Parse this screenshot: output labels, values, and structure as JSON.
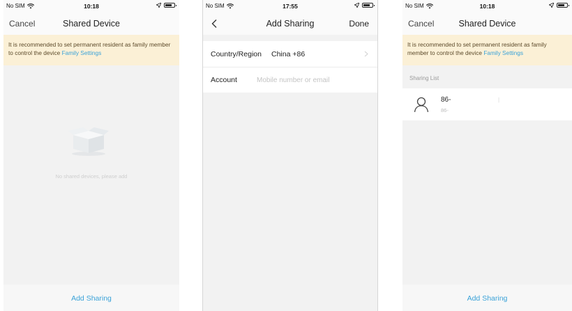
{
  "screens": [
    {
      "status": {
        "carrier": "No SIM",
        "time": "10:18"
      },
      "nav": {
        "left": "Cancel",
        "title": "Shared Device"
      },
      "banner": {
        "text": "It is recommended to set permanent resident as family member to control the device",
        "link": "Family Settings"
      },
      "empty": {
        "text": "No shared devices, please add"
      },
      "footer": {
        "label": "Add Sharing"
      }
    },
    {
      "status": {
        "carrier": "No SIM",
        "time": "17:55"
      },
      "nav": {
        "title": "Add Sharing",
        "right": "Done"
      },
      "form": {
        "country_label": "Country/Region",
        "country_value": "China +86",
        "account_label": "Account",
        "account_placeholder": "Mobile number or email"
      }
    },
    {
      "status": {
        "carrier": "No SIM",
        "time": "10:18"
      },
      "nav": {
        "left": "Cancel",
        "title": "Shared Device"
      },
      "banner": {
        "text": "It is recommended to set permanent resident as family member to control the device",
        "link": "Family Settings"
      },
      "list": {
        "header": "Sharing List",
        "items": [
          {
            "name": "86-",
            "sub": "86-",
            "mark": "|"
          }
        ]
      },
      "footer": {
        "label": "Add Sharing"
      }
    }
  ],
  "colors": {
    "accent": "#3aa2d8",
    "banner_bg": "#fbf0d6",
    "page_bg": "#f2f2f2"
  },
  "icons": [
    "wifi-icon",
    "location-arrow-icon",
    "battery-icon",
    "back-chevron-icon",
    "chevron-right-icon",
    "empty-box-icon",
    "user-avatar-icon"
  ]
}
